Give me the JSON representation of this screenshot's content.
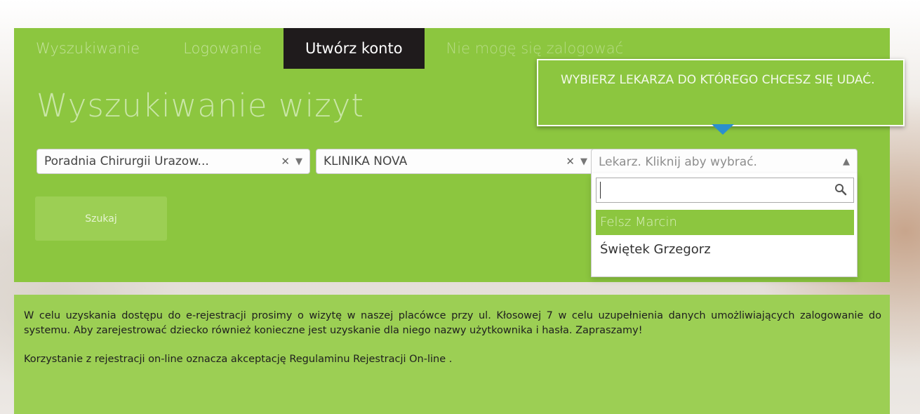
{
  "nav": {
    "items": [
      {
        "label": "Wyszukiwanie"
      },
      {
        "label": "Logowanie"
      },
      {
        "label": "Utwórz konto"
      },
      {
        "label": "Nie mogę się zalogować"
      }
    ],
    "active_index": 2
  },
  "page_title": "Wyszukiwanie wizyt",
  "filters": {
    "clinic_select": {
      "value": "Poradnia Chirurgii Urazow..."
    },
    "facility_select": {
      "value": "KLINIKA NOVA"
    },
    "doctor_select": {
      "placeholder": "Lekarz. Kliknij aby wybrać."
    }
  },
  "search_button": {
    "label": "Szukaj"
  },
  "tooltip": {
    "text": "WYBIERZ LEKARZA DO KTÓREGO CHCESZ SIĘ UDAĆ."
  },
  "dropdown": {
    "search_value": "",
    "options": [
      {
        "label": "Felsz Marcin",
        "highlighted": true
      },
      {
        "label": "Świętek Grzegorz",
        "highlighted": false
      }
    ]
  },
  "info": {
    "paragraph1": "W celu uzyskania dostępu do e-rejestracji prosimy o wizytę w naszej placówce przy ul. Kłosowej 7 w celu uzupełnienia danych umożliwiających zalogowanie do systemu. Aby zarejestrować dziecko również konieczne jest uzyskanie dla niego nazwy użytkownika i hasła. Zapraszamy!",
    "paragraph2": "Korzystanie z rejestracji on-line oznacza akceptację Regulaminu Rejestracji On-line ."
  },
  "colors": {
    "primary_green": "#8cc63f",
    "active_nav": "#1f1b1c",
    "tooltip_arrow": "#2b8fce"
  },
  "icons": {
    "clear": "close-icon",
    "dropdown": "chevron-down-icon",
    "dropdown_open": "chevron-up-icon",
    "search": "search-icon"
  }
}
